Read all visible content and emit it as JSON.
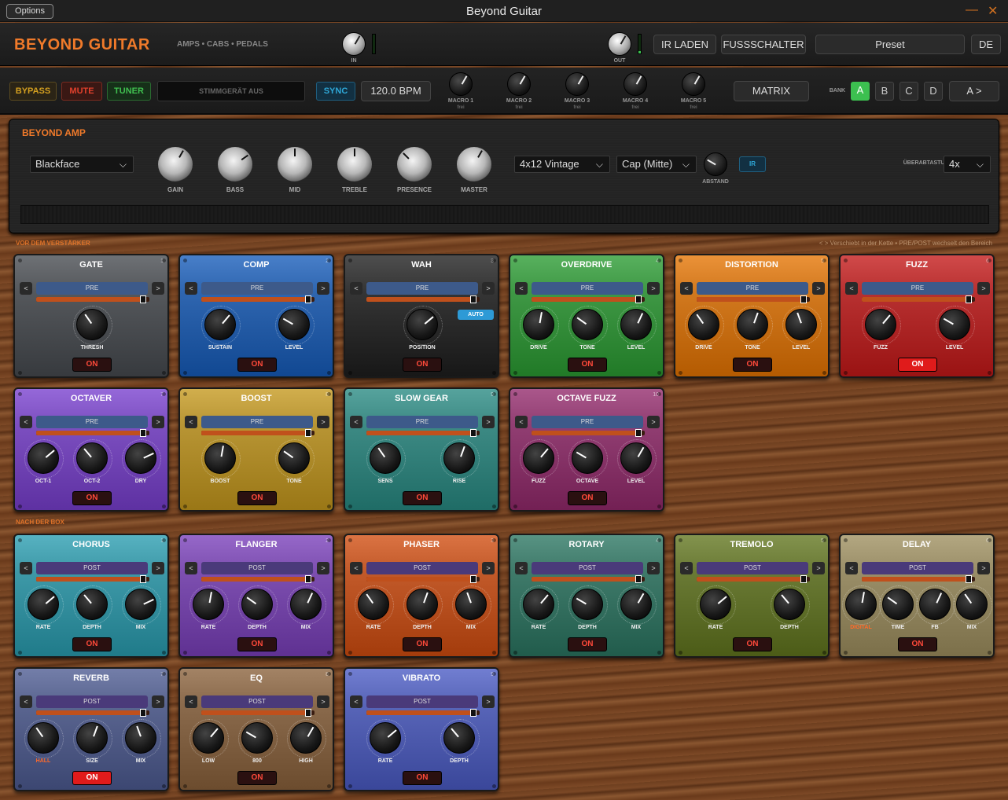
{
  "window": {
    "title": "Beyond Guitar",
    "options_label": "Options"
  },
  "header": {
    "brand": "BEYOND GUITAR",
    "subtitle": "AMPS • CABS • PEDALS",
    "in_label": "IN",
    "out_label": "OUT",
    "ir_load": "IR LADEN",
    "footswitch": "FUSSSCHALTER",
    "preset": "Preset",
    "language": "DE"
  },
  "toolbar": {
    "bypass": "BYPASS",
    "mute": "MUTE",
    "tuner": "TUNER",
    "tuner_status": "STIMMGERÄT AUS",
    "sync": "SYNC",
    "bpm": "120.0 BPM",
    "macros": [
      {
        "label": "MACRO 1",
        "sub": "frei"
      },
      {
        "label": "MACRO 2",
        "sub": "frei"
      },
      {
        "label": "MACRO 3",
        "sub": "frei"
      },
      {
        "label": "MACRO 4",
        "sub": "frei"
      },
      {
        "label": "MACRO 5",
        "sub": "frei"
      }
    ],
    "matrix": "MATRIX",
    "bank_label": "BANK",
    "banks": [
      "A",
      "B",
      "C",
      "D"
    ],
    "active_bank": "A",
    "ab_toggle": "A >"
  },
  "amp": {
    "title": "BEYOND AMP",
    "model": "Blackface",
    "knobs": [
      "GAIN",
      "BASS",
      "MID",
      "TREBLE",
      "PRESENCE",
      "MASTER"
    ],
    "cab": "4x12 Vintage",
    "mic": "Cap (Mitte)",
    "distance_label": "ABSTAND",
    "ir_label": "IR",
    "oversampling_label": "ÜBERABTASTUNG",
    "oversampling": "4x"
  },
  "sections": {
    "pre": "VOR DEM VERSTÄRKER",
    "post": "NACH DER BOX",
    "hint": "< > Verschiebt in der Kette  •  PRE/POST wechselt den Bereich"
  },
  "pedals": [
    {
      "name": "GATE",
      "num": "1",
      "mode": "PRE",
      "knobs": [
        "THRESH"
      ],
      "on": "ON",
      "lit": false,
      "color": "#55585c"
    },
    {
      "name": "COMP",
      "num": "2",
      "mode": "PRE",
      "knobs": [
        "SUSTAIN",
        "LEVEL"
      ],
      "on": "ON",
      "lit": false,
      "color": "#2f66b0"
    },
    {
      "name": "WAH",
      "num": "3",
      "mode": "PRE",
      "knobs": [
        "POSITION"
      ],
      "on": "ON",
      "lit": false,
      "color": "#353535",
      "auto": "AUTO"
    },
    {
      "name": "OVERDRIVE",
      "num": "4",
      "mode": "PRE",
      "knobs": [
        "DRIVE",
        "TONE",
        "LEVEL"
      ],
      "on": "ON",
      "lit": false,
      "color": "#3f9845"
    },
    {
      "name": "DISTORTION",
      "num": "5",
      "mode": "PRE",
      "knobs": [
        "DRIVE",
        "TONE",
        "LEVEL"
      ],
      "on": "ON",
      "lit": false,
      "color": "#d2791f"
    },
    {
      "name": "FUZZ",
      "num": "6",
      "mode": "PRE",
      "knobs": [
        "FUZZ",
        "LEVEL"
      ],
      "on": "ON",
      "lit": true,
      "color": "#b83131"
    },
    {
      "name": "OCTAVER",
      "num": "7",
      "mode": "PRE",
      "knobs": [
        "OCT-1",
        "OCT-2",
        "DRY"
      ],
      "on": "ON",
      "lit": false,
      "color": "#7c4fc0"
    },
    {
      "name": "BOOST",
      "num": "8",
      "mode": "PRE",
      "knobs": [
        "BOOST",
        "TONE"
      ],
      "on": "ON",
      "lit": false,
      "color": "#b89534"
    },
    {
      "name": "SLOW GEAR",
      "num": "9",
      "mode": "PRE",
      "knobs": [
        "SENS",
        "RISE"
      ],
      "on": "ON",
      "lit": false,
      "color": "#3d8a84"
    },
    {
      "name": "OCTAVE FUZZ",
      "num": "10",
      "mode": "PRE",
      "knobs": [
        "FUZZ",
        "OCTAVE",
        "LEVEL"
      ],
      "on": "ON",
      "lit": false,
      "color": "#913e72"
    },
    {
      "name": "CHORUS",
      "num": "1",
      "mode": "POST",
      "knobs": [
        "RATE",
        "DEPTH",
        "MIX"
      ],
      "on": "ON",
      "lit": false,
      "color": "#3e99a8"
    },
    {
      "name": "FLANGER",
      "num": "2",
      "mode": "POST",
      "knobs": [
        "RATE",
        "DEPTH",
        "MIX"
      ],
      "on": "ON",
      "lit": false,
      "color": "#7d4fb0"
    },
    {
      "name": "PHASER",
      "num": "3",
      "mode": "POST",
      "knobs": [
        "RATE",
        "DEPTH",
        "MIX"
      ],
      "on": "ON",
      "lit": false,
      "color": "#c25a2a"
    },
    {
      "name": "ROTARY",
      "num": "4",
      "mode": "POST",
      "knobs": [
        "RATE",
        "DEPTH",
        "MIX"
      ],
      "on": "ON",
      "lit": false,
      "color": "#3f7a6a"
    },
    {
      "name": "TREMOLO",
      "num": "5",
      "mode": "POST",
      "knobs": [
        "RATE",
        "DEPTH"
      ],
      "on": "ON",
      "lit": false,
      "color": "#6a7a35"
    },
    {
      "name": "DELAY",
      "num": "6",
      "mode": "POST",
      "knobs": [
        "DIGITAL",
        "TIME",
        "FB",
        "MIX"
      ],
      "on": "ON",
      "lit": false,
      "color": "#9a8e68",
      "highlight": "DIGITAL"
    },
    {
      "name": "REVERB",
      "num": "7",
      "mode": "POST",
      "knobs": [
        "HALL",
        "SIZE",
        "MIX"
      ],
      "on": "ON",
      "lit": true,
      "color": "#5a6590",
      "highlight": "HALL"
    },
    {
      "name": "EQ",
      "num": "8",
      "mode": "POST",
      "knobs": [
        "LOW",
        "800",
        "HIGH"
      ],
      "on": "ON",
      "lit": false,
      "color": "#8a6a4c"
    },
    {
      "name": "VIBRATO",
      "num": "9",
      "mode": "POST",
      "knobs": [
        "RATE",
        "DEPTH"
      ],
      "on": "ON",
      "lit": false,
      "color": "#5865b8"
    }
  ],
  "colors": {
    "accent": "#f07a2a",
    "bypass": "#d4a020",
    "mute": "#e0402c",
    "tuner": "#40c050",
    "sync": "#2fa8d8",
    "bank_active": "#3cc050"
  }
}
